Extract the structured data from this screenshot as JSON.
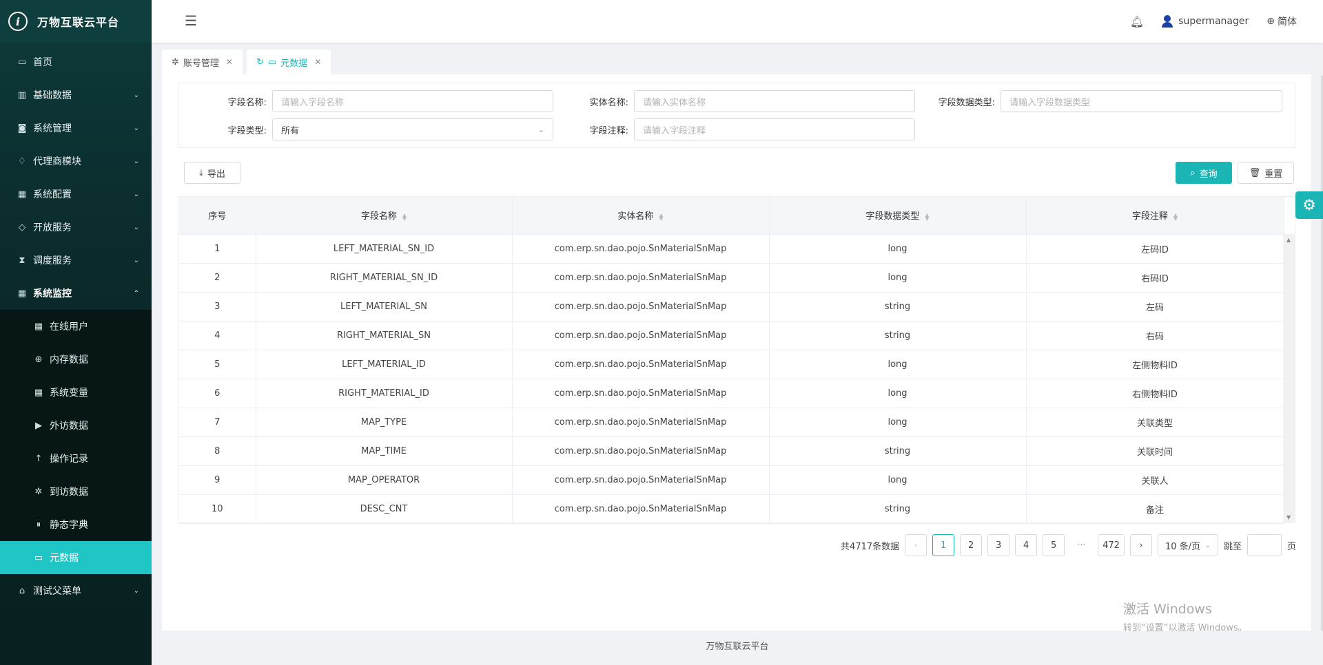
{
  "app": {
    "title": "万物互联云平台",
    "logo_letter": "i"
  },
  "sidebar": {
    "items": [
      {
        "label": "首页",
        "icon": "calendar-icon"
      },
      {
        "label": "基础数据",
        "icon": "barcode-icon"
      },
      {
        "label": "系统管理",
        "icon": "camera-icon"
      },
      {
        "label": "代理商模块",
        "icon": "bell-icon"
      },
      {
        "label": "系统配置",
        "icon": "grid-icon"
      },
      {
        "label": "开放服务",
        "icon": "tag-icon"
      },
      {
        "label": "调度服务",
        "icon": "hourglass-icon"
      },
      {
        "label": "系统监控",
        "icon": "grid-icon"
      }
    ],
    "submenu": [
      {
        "label": "在线用户"
      },
      {
        "label": "内存数据"
      },
      {
        "label": "系统变量"
      },
      {
        "label": "外访数据"
      },
      {
        "label": "操作记录"
      },
      {
        "label": "到访数据"
      },
      {
        "label": "静态字典"
      },
      {
        "label": "元数据"
      }
    ],
    "last_item": {
      "label": "测试父菜单",
      "icon": "bank-icon"
    }
  },
  "header": {
    "username": "supermanager",
    "language": "简体"
  },
  "tabs": [
    {
      "label": "账号管理"
    },
    {
      "label": "元数据"
    }
  ],
  "filter": {
    "field_name_label": "字段名称:",
    "field_name_placeholder": "请输入字段名称",
    "entity_name_label": "实体名称:",
    "entity_name_placeholder": "请输入实体名称",
    "data_type_label": "字段数据类型:",
    "data_type_placeholder": "请输入字段数据类型",
    "field_type_label": "字段类型:",
    "field_type_value": "所有",
    "comment_label": "字段注释:",
    "comment_placeholder": "请输入字段注释"
  },
  "toolbar": {
    "export": "导出",
    "query": "查询",
    "reset": "重置"
  },
  "table": {
    "headers": [
      "序号",
      "字段名称",
      "实体名称",
      "字段数据类型",
      "字段注释"
    ],
    "rows": [
      [
        "1",
        "LEFT_MATERIAL_SN_ID",
        "com.erp.sn.dao.pojo.SnMaterialSnMap",
        "long",
        "左码ID"
      ],
      [
        "2",
        "RIGHT_MATERIAL_SN_ID",
        "com.erp.sn.dao.pojo.SnMaterialSnMap",
        "long",
        "右码ID"
      ],
      [
        "3",
        "LEFT_MATERIAL_SN",
        "com.erp.sn.dao.pojo.SnMaterialSnMap",
        "string",
        "左码"
      ],
      [
        "4",
        "RIGHT_MATERIAL_SN",
        "com.erp.sn.dao.pojo.SnMaterialSnMap",
        "string",
        "右码"
      ],
      [
        "5",
        "LEFT_MATERIAL_ID",
        "com.erp.sn.dao.pojo.SnMaterialSnMap",
        "long",
        "左侧物料ID"
      ],
      [
        "6",
        "RIGHT_MATERIAL_ID",
        "com.erp.sn.dao.pojo.SnMaterialSnMap",
        "long",
        "右侧物料ID"
      ],
      [
        "7",
        "MAP_TYPE",
        "com.erp.sn.dao.pojo.SnMaterialSnMap",
        "long",
        "关联类型"
      ],
      [
        "8",
        "MAP_TIME",
        "com.erp.sn.dao.pojo.SnMaterialSnMap",
        "string",
        "关联时间"
      ],
      [
        "9",
        "MAP_OPERATOR",
        "com.erp.sn.dao.pojo.SnMaterialSnMap",
        "long",
        "关联人"
      ],
      [
        "10",
        "DESC_CNT",
        "com.erp.sn.dao.pojo.SnMaterialSnMap",
        "string",
        "备注"
      ]
    ]
  },
  "pagination": {
    "total": "共4717条数据",
    "pages": [
      "1",
      "2",
      "3",
      "4",
      "5"
    ],
    "ellipsis": "···",
    "last": "472",
    "page_size": "10 条/页",
    "jump_label": "跳至",
    "page_suffix": "页",
    "current": 1
  },
  "footer": {
    "text": "万物互联云平台"
  },
  "watermark": {
    "line1": "激活 Windows",
    "line2": "转到“设置”以激活 Windows。"
  },
  "colors": {
    "accent": "#1cb5b6",
    "sidebar_bg": "#0b2a2b"
  }
}
